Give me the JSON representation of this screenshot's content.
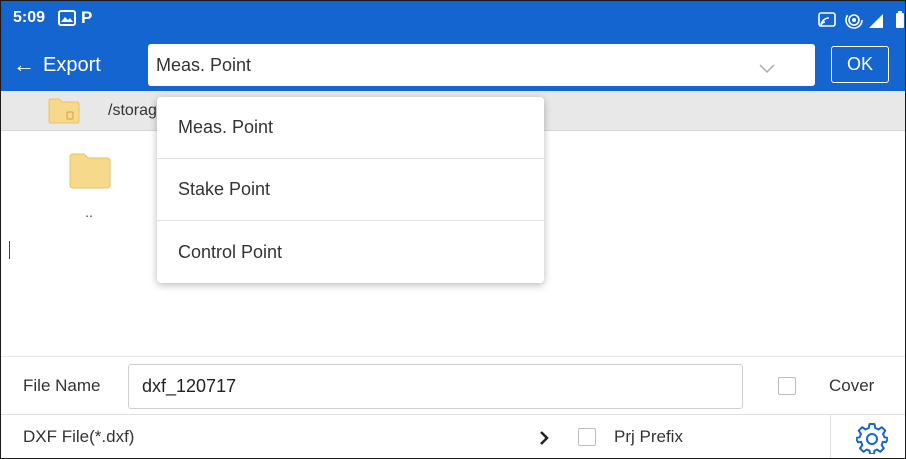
{
  "status_bar": {
    "time": "5:09",
    "icons": [
      "gallery-icon",
      "parking-icon",
      "cast-icon",
      "hotspot-icon",
      "signal-icon",
      "battery-icon"
    ],
    "parking_glyph": "P"
  },
  "toolbar": {
    "back_label": "Export",
    "back_arrow": "←",
    "select_value": "Meas. Point",
    "ok_label": "OK"
  },
  "path_bar": {
    "path": "/storag"
  },
  "file_list": {
    "parent_label": ".."
  },
  "dropdown": {
    "options": [
      "Meas. Point",
      "Stake Point",
      "Control Point"
    ]
  },
  "bottom": {
    "filename_label": "File Name",
    "filename_value": "dxf_120717",
    "cover_label": "Cover",
    "cover_checked": false,
    "format_label": "DXF File(*.dxf)",
    "format_chevron": "›",
    "prefix_label": "Prj Prefix",
    "prefix_checked": false
  },
  "colors": {
    "primary": "#1565d0",
    "folder": "#f7d98b",
    "settings_icon": "#1565d0"
  }
}
